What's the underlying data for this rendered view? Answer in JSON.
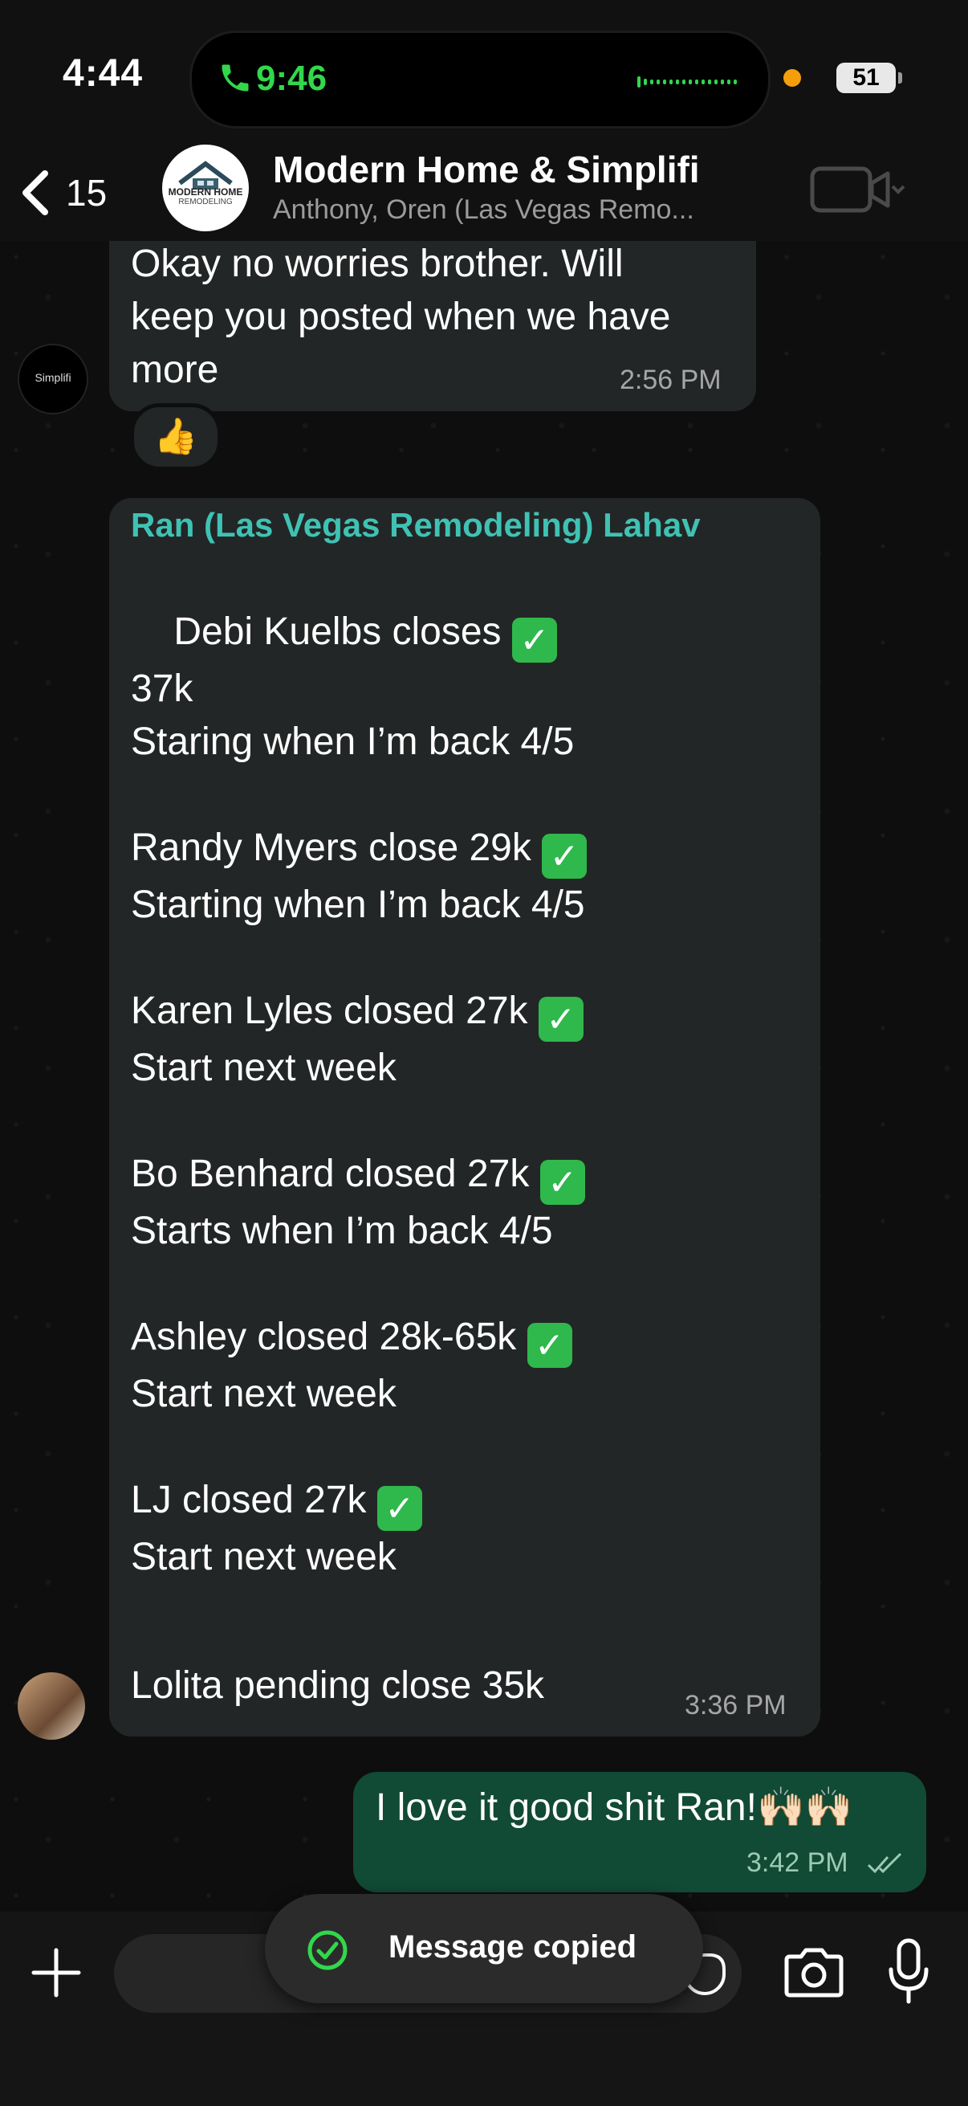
{
  "status_bar": {
    "time": "4:44",
    "call_time": "9:46",
    "battery": "51"
  },
  "header": {
    "back_count": "15",
    "avatar_line1": "MODERN HOME",
    "avatar_line2": "REMODELING",
    "group_name": "Modern Home & Simplifi",
    "group_subtitle": "Anthony, Oren (Las Vegas Remo..."
  },
  "messages": {
    "m1": {
      "avatar_label": "Simplifi",
      "text": "Okay no worries brother. Will\nkeep you posted when we have\nmore",
      "time": "2:56 PM",
      "reaction": "👍"
    },
    "m2": {
      "sender": "Ran (Las Vegas Remodeling) Lahav",
      "line1": "Debi Kuelbs closes",
      "line2": "37k\nStaring when I’m back 4/5\n",
      "line3": "Randy Myers close 29k",
      "line4": "Starting when I’m back 4/5\n",
      "line5": "Karen Lyles closed 27k",
      "line6": "Start next week\n",
      "line7": "Bo Benhard closed 27k",
      "line8": "Starts when I’m back 4/5\n",
      "line9": "Ashley closed 28k-65k",
      "line10": "Start next week\n",
      "line11": "LJ closed 27k",
      "line12": "Start next week",
      "line13": "Lolita pending close 35k",
      "time": "3:36 PM"
    },
    "m3": {
      "text": "I love it good shit Ran!🙌🏻🙌🏻",
      "time": "3:42 PM"
    }
  },
  "toast": {
    "text": "Message copied"
  },
  "colors": {
    "accent_green": "#32d74b",
    "sender_teal": "#3fc2b4",
    "outgoing_bubble": "#114a35",
    "incoming_bubble": "#232626"
  },
  "icons": [
    "phone-icon",
    "back-chevron-icon",
    "video-camera-icon",
    "thumbs-up-icon",
    "check-mark-icon",
    "double-check-icon",
    "plus-icon",
    "sticker-icon",
    "camera-icon",
    "microphone-icon",
    "toast-check-icon"
  ]
}
